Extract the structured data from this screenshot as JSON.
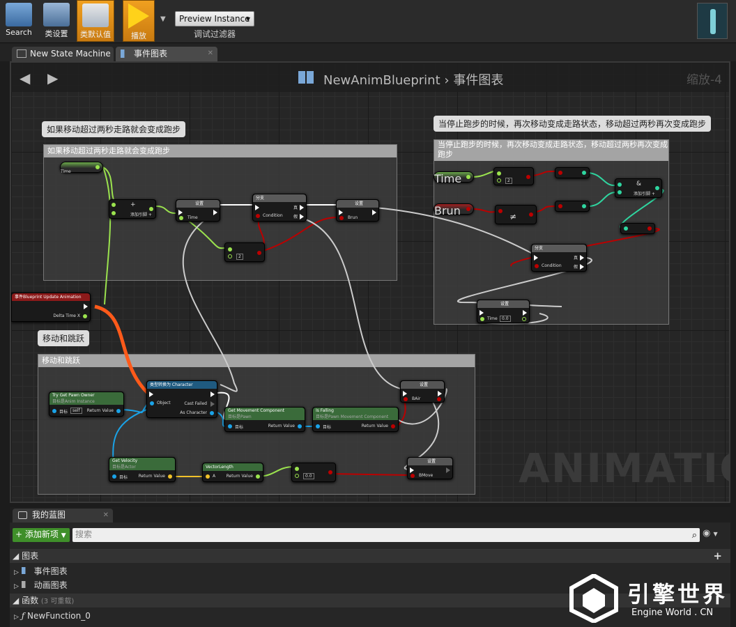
{
  "toolbar": {
    "search_label": "Search",
    "class_settings_label": "类设置",
    "class_defaults_label": "类默认值",
    "play_label": "播放",
    "preview_instance": "Preview Instance",
    "debug_filter": "调试过滤器"
  },
  "tabs": [
    {
      "label": "New State Machine"
    },
    {
      "label": "事件图表"
    }
  ],
  "graph": {
    "crumb_asset": "NewAnimBlueprint",
    "crumb_sep": "›",
    "crumb_graph": "事件图表",
    "zoom": "缩放-4",
    "watermark": "ANIMATION",
    "comments": [
      {
        "bubble": "如果移动超过两秒走路就会变成跑步",
        "title": "如果移动超过两秒走路就会变成跑步"
      },
      {
        "bubble": "当停止跑步的时候，再次移动变成走路状态，移动超过两秒再次变成跑步",
        "title": "当停止跑步的时候，再次移动变成走路状态，移动超过两秒再次变成跑步"
      },
      {
        "bubble": "移动和跳跃",
        "title": "移动和跳跃"
      }
    ],
    "nodes": {
      "time_get": "Time",
      "add_title": "+",
      "add_pin": "添加引脚 +",
      "set1_title": "设置",
      "set1_pin": "Time",
      "branch_title": "分支",
      "branch_true": "真",
      "branch_false": "假",
      "branch_condition": "Condition",
      "set_brun_title": "设置",
      "set_brun_pin": "Brun",
      "greater_label": "2",
      "event_title": "事件Blueprint Update Animation",
      "event_pin": "Delta Time X",
      "r_time_get": "Time",
      "r_brun_get": "Brun",
      "r_greater": "2",
      "r_and_title": "&",
      "r_and_pin": "添加引脚 +",
      "r_branch_title": "分支",
      "r_branch_true": "真",
      "r_branch_false": "假",
      "r_branch_condition": "Condition",
      "r_set_title": "设置",
      "r_set_pin": "Time",
      "r_set_value": "0.0",
      "pawn_title": "Try Get Pawn Owner",
      "pawn_sub": "目标是Anim Instance",
      "pawn_target": "目标",
      "pawn_self": "self",
      "pawn_return": "Return Value",
      "cast_title": "类型转换为 Character",
      "cast_object": "Object",
      "cast_failed": "Cast Failed",
      "cast_as": "As Character",
      "move_title": "Get Movement Component",
      "move_sub": "目标是Pawn",
      "move_target": "目标",
      "move_return": "Return Value",
      "fall_title": "Is Falling",
      "fall_sub": "目标是Pawn Movement Component",
      "fall_target": "目标",
      "fall_return": "Return Value",
      "bair_title": "设置",
      "bair_pin": "BAir",
      "vel_title": "Get Velocity",
      "vel_sub": "目标是Actor",
      "vel_target": "目标",
      "vel_return": "Return Value",
      "vlen_title": "VectorLength",
      "vlen_a": "A",
      "vlen_return": "Return Value",
      "gt_value": "0.0",
      "bmove_title": "设置",
      "bmove_pin": "BMove"
    }
  },
  "blueprint_panel": {
    "tab_label": "我的蓝图",
    "add_new": "添加新项",
    "search_placeholder": "搜索",
    "graphs_section": "图表",
    "event_graph": "事件图表",
    "anim_graph": "动画图表",
    "functions_section": "函数",
    "functions_note": "(3 可重载)",
    "function0": "NewFunction_0"
  },
  "branding": {
    "cn": "引擎世界",
    "en": "Engine World . CN"
  },
  "colors": {
    "exec": "#ffffff",
    "float": "#9be34e",
    "bool": "#8c0f0f",
    "object": "#1aa3e8",
    "vector": "#f0c12a",
    "active_wire": "#ff5a1a",
    "branch_header": "#5a5a5a",
    "set_header": "#555555",
    "func_header": "#3a6b3a",
    "cast_header": "#1f5a80",
    "event_header": "#8c1a1a"
  }
}
